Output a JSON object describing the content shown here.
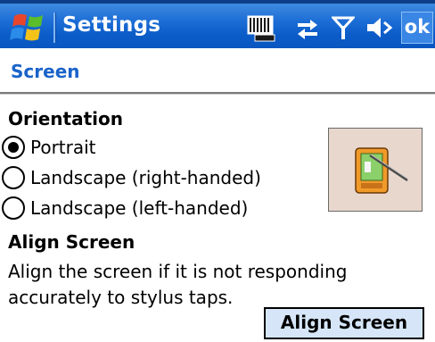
{
  "titlebar": {
    "title": "Settings",
    "ok_label": "ok",
    "icons": [
      "windows-start-icon",
      "input-panel-icon",
      "connectivity-icon",
      "signal-icon",
      "volume-icon"
    ]
  },
  "page": {
    "title": "Screen"
  },
  "orientation": {
    "heading": "Orientation",
    "options": [
      {
        "label": "Portrait",
        "selected": true
      },
      {
        "label": "Landscape (right-handed)",
        "selected": false
      },
      {
        "label": "Landscape (left-handed)",
        "selected": false
      }
    ],
    "preview_icon": "device-orientation-icon"
  },
  "align": {
    "heading": "Align Screen",
    "description": "Align the screen if it is not responding accurately to stylus taps.",
    "button_label": "Align Screen"
  },
  "colors": {
    "titlebar": "#0b5cc8",
    "accent": "#1a63c9",
    "button_bg": "#d6e6f8",
    "preview_bg": "#e8d7cd"
  }
}
